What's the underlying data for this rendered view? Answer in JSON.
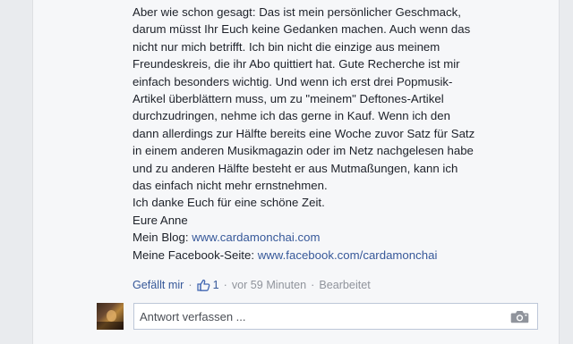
{
  "comment": {
    "lines": [
      "Aber wie schon gesagt: Das ist mein persönlicher Geschmack,",
      "darum müsst Ihr Euch keine Gedanken machen. Auch wenn das",
      "nicht nur mich betrifft. Ich bin nicht die einzige aus meinem",
      "Freundeskreis, die ihr Abo quittiert hat. Gute Recherche ist mir",
      "einfach besonders wichtig. Und wenn ich erst drei Popmusik-",
      "Artikel überblättern muss, um zu \"meinem\" Deftones-Artikel",
      "durchzudringen, nehme ich das gerne in Kauf. Wenn ich den",
      "dann allerdings zur Hälfte bereits eine Woche zuvor Satz für Satz",
      "in einem anderen Musikmagazin oder im Netz nachgelesen habe",
      "und zu anderen Hälfte besteht er aus Mutmaßungen, kann ich",
      "das einfach nicht mehr ernstnehmen.",
      "Ich danke Euch für eine schöne Zeit.",
      "Eure Anne"
    ],
    "blog_label": "Mein Blog: ",
    "blog_link": "www.cardamonchai.com",
    "facebook_label": "Meine Facebook-Seite: ",
    "facebook_link": "www.facebook.com/cardamonchai"
  },
  "meta": {
    "like_label": "Gefällt mir",
    "like_count": "1",
    "time": "vor 59 Minuten",
    "edited": "Bearbeitet",
    "separator": "·",
    "like_icon": "thumbs-up-icon"
  },
  "reply": {
    "placeholder": "Antwort verfassen ...",
    "camera_icon": "camera-icon"
  },
  "colors": {
    "link": "#365899",
    "text": "#1d2129",
    "muted": "#90949c",
    "input_border": "#bdc7d8"
  }
}
